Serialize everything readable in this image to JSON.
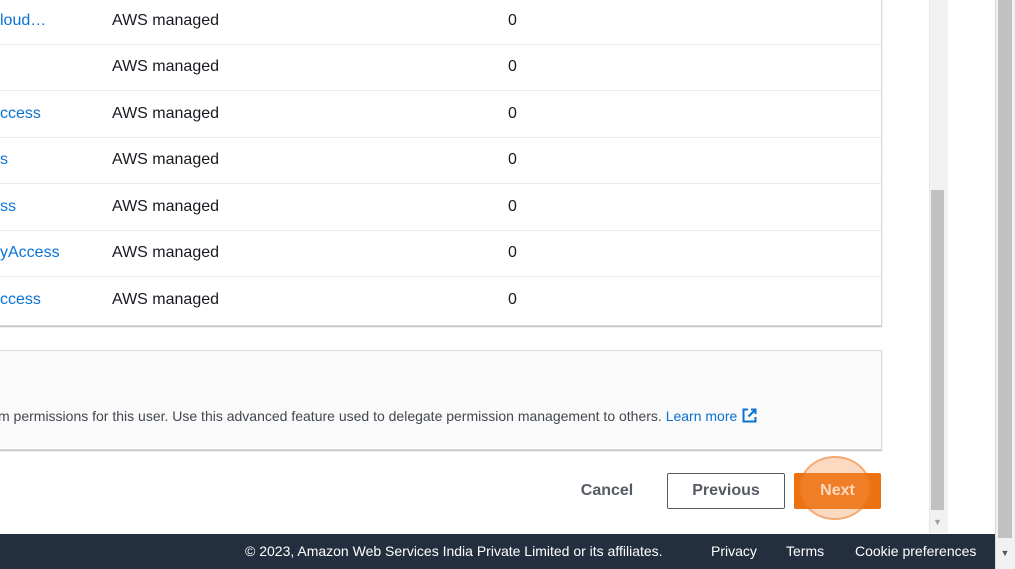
{
  "policies_table": {
    "rows": [
      {
        "name": "loud…",
        "type": "AWS managed",
        "attached": "0"
      },
      {
        "name": "",
        "type": "AWS managed",
        "attached": "0"
      },
      {
        "name": "ccess",
        "type": "AWS managed",
        "attached": "0"
      },
      {
        "name": "s",
        "type": "AWS managed",
        "attached": "0"
      },
      {
        "name": "ss",
        "type": "AWS managed",
        "attached": "0"
      },
      {
        "name": "yAccess",
        "type": "AWS managed",
        "attached": "0"
      },
      {
        "name": "ccess",
        "type": "AWS managed",
        "attached": "0"
      }
    ]
  },
  "permissions_boundary": {
    "description": "m permissions for this user. Use this advanced feature used to delegate permission management to others.",
    "learn_more": "Learn more",
    "learn_more_icon": "external-link-icon"
  },
  "actions": {
    "cancel": "Cancel",
    "previous": "Previous",
    "next": "Next"
  },
  "footer": {
    "copyright": "© 2023, Amazon Web Services India Private Limited or its affiliates.",
    "privacy": "Privacy",
    "terms": "Terms",
    "cookie": "Cookie preferences"
  },
  "colors": {
    "link": "#0972d3",
    "primary_button": "#ec7211",
    "footer_bg": "#232f3e"
  }
}
